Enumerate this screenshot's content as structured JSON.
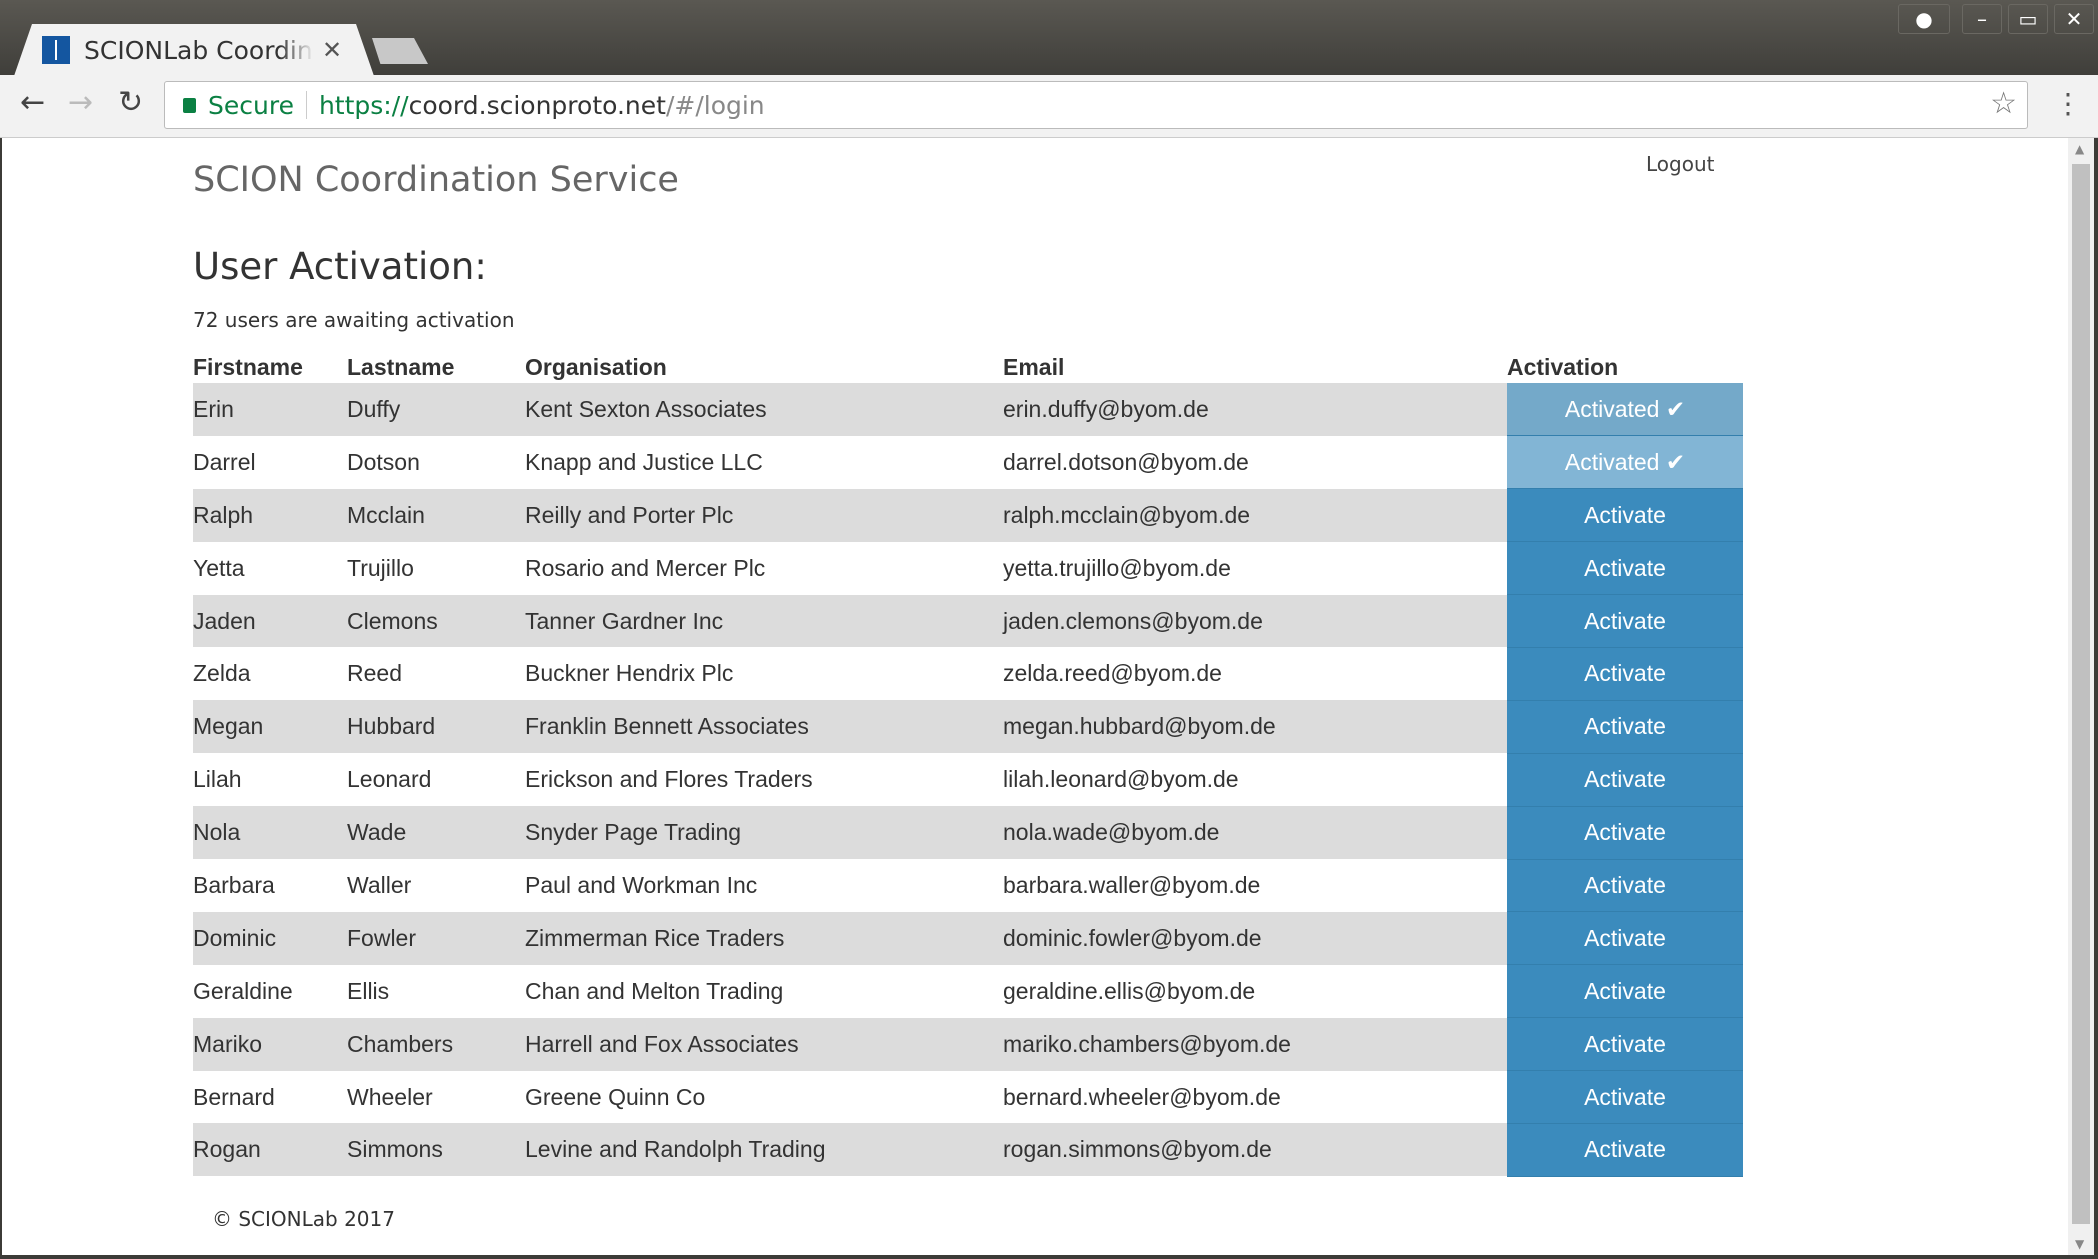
{
  "browser": {
    "tab_title": "SCIONLab Coordination Service",
    "url_secure_label": "Secure",
    "url_scheme": "https://",
    "url_host": "coord.scionproto.net",
    "url_path": "/#/login"
  },
  "header": {
    "brand": "SCION Coordination Service",
    "logout": "Logout"
  },
  "main": {
    "title": "User Activation:",
    "count_text": "72 users are awaiting activation",
    "columns": [
      "Firstname",
      "Lastname",
      "Organisation",
      "Email",
      "Activation"
    ],
    "rows": [
      {
        "first": "Erin",
        "last": "Duffy",
        "org": "Kent Sexton Associates",
        "email": "erin.duffy@byom.de",
        "status": "Activated ✔"
      },
      {
        "first": "Darrel",
        "last": "Dotson",
        "org": "Knapp and Justice LLC",
        "email": "darrel.dotson@byom.de",
        "status": "Activated ✔"
      },
      {
        "first": "Ralph",
        "last": "Mcclain",
        "org": "Reilly and Porter Plc",
        "email": "ralph.mcclain@byom.de",
        "status": "Activate"
      },
      {
        "first": "Yetta",
        "last": "Trujillo",
        "org": "Rosario and Mercer Plc",
        "email": "yetta.trujillo@byom.de",
        "status": "Activate"
      },
      {
        "first": "Jaden",
        "last": "Clemons",
        "org": "Tanner Gardner Inc",
        "email": "jaden.clemons@byom.de",
        "status": "Activate"
      },
      {
        "first": "Zelda",
        "last": "Reed",
        "org": "Buckner Hendrix Plc",
        "email": "zelda.reed@byom.de",
        "status": "Activate"
      },
      {
        "first": "Megan",
        "last": "Hubbard",
        "org": "Franklin Bennett Associates",
        "email": "megan.hubbard@byom.de",
        "status": "Activate"
      },
      {
        "first": "Lilah",
        "last": "Leonard",
        "org": "Erickson and Flores Traders",
        "email": "lilah.leonard@byom.de",
        "status": "Activate"
      },
      {
        "first": "Nola",
        "last": "Wade",
        "org": "Snyder Page Trading",
        "email": "nola.wade@byom.de",
        "status": "Activate"
      },
      {
        "first": "Barbara",
        "last": "Waller",
        "org": "Paul and Workman Inc",
        "email": "barbara.waller@byom.de",
        "status": "Activate"
      },
      {
        "first": "Dominic",
        "last": "Fowler",
        "org": "Zimmerman Rice Traders",
        "email": "dominic.fowler@byom.de",
        "status": "Activate"
      },
      {
        "first": "Geraldine",
        "last": "Ellis",
        "org": "Chan and Melton Trading",
        "email": "geraldine.ellis@byom.de",
        "status": "Activate"
      },
      {
        "first": "Mariko",
        "last": "Chambers",
        "org": "Harrell and Fox Associates",
        "email": "mariko.chambers@byom.de",
        "status": "Activate"
      },
      {
        "first": "Bernard",
        "last": "Wheeler",
        "org": "Greene Quinn Co",
        "email": "bernard.wheeler@byom.de",
        "status": "Activate"
      },
      {
        "first": "Rogan",
        "last": "Simmons",
        "org": "Levine and Randolph Trading",
        "email": "rogan.simmons@byom.de",
        "status": "Activate"
      }
    ]
  },
  "footer": {
    "text": "© SCIONLab 2017"
  },
  "colors": {
    "activate": "#3b8bbd",
    "activated": "#74a9c9",
    "row_stripe": "#dcdcdc"
  }
}
